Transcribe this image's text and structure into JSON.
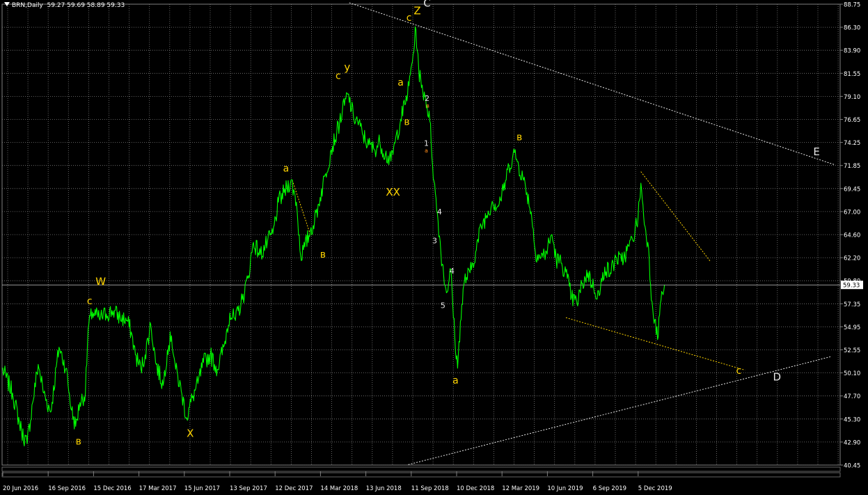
{
  "window": {
    "symbol_timeframe": "BRN,Daily",
    "ohlc": "59.27 59.69 58.89 59.33"
  },
  "colors": {
    "background": "#000000",
    "grid": "#7f7f7f",
    "price_line": "#00ff00",
    "wave_label_yellow": "#ffd400",
    "wave_label_white": "#e6e6e6",
    "trendline_white": "#e8e8e8",
    "trendline_yellow": "#ffd400",
    "axis_text": "#ffffff"
  },
  "chart_data": {
    "type": "line",
    "title": "",
    "xlabel": "",
    "ylabel": "",
    "ylim": [
      40.45,
      88.75
    ],
    "grid": true,
    "current_price": 59.33,
    "y_ticks": [
      "88.75",
      "86.30",
      "83.90",
      "81.55",
      "79.10",
      "76.65",
      "74.25",
      "71.85",
      "69.45",
      "67.00",
      "64.60",
      "62.20",
      "59.80",
      "57.35",
      "54.95",
      "52.55",
      "50.10",
      "47.70",
      "45.30",
      "42.90",
      "40.45"
    ],
    "x_ticks": [
      "20 Jun 2016",
      "16 Sep 2016",
      "15 Dec 2016",
      "17 Mar 2017",
      "15 Jun 2017",
      "13 Sep 2017",
      "12 Dec 2017",
      "14 Mar 2018",
      "13 Jun 2018",
      "11 Sep 2018",
      "10 Dec 2018",
      "12 Mar 2019",
      "10 Jun 2019",
      "6 Sep 2019",
      "5 Dec 2019"
    ],
    "x_range": [
      0,
      1207
    ],
    "series": [
      {
        "points": [
          [
            0,
            50.6
          ],
          [
            15,
            48
          ],
          [
            28,
            44
          ],
          [
            36,
            42.7
          ],
          [
            44,
            47
          ],
          [
            52,
            51
          ],
          [
            60,
            48
          ],
          [
            70,
            46
          ],
          [
            82,
            52.8
          ],
          [
            92,
            50.6
          ],
          [
            100,
            46.2
          ],
          [
            106,
            44.5
          ],
          [
            112,
            47
          ],
          [
            120,
            48
          ],
          [
            124,
            54.8
          ],
          [
            130,
            56.5
          ],
          [
            140,
            55.8
          ],
          [
            150,
            56.3
          ],
          [
            160,
            56.6
          ],
          [
            170,
            55.9
          ],
          [
            180,
            55.6
          ],
          [
            186,
            54.4
          ],
          [
            192,
            52
          ],
          [
            200,
            50.5
          ],
          [
            206,
            52
          ],
          [
            214,
            55.2
          ],
          [
            222,
            51
          ],
          [
            232,
            48.8
          ],
          [
            238,
            52.5
          ],
          [
            244,
            54
          ],
          [
            250,
            50.5
          ],
          [
            258,
            48.2
          ],
          [
            266,
            45.4
          ],
          [
            274,
            47.5
          ],
          [
            282,
            49
          ],
          [
            290,
            51.2
          ],
          [
            300,
            52
          ],
          [
            310,
            50.5
          ],
          [
            320,
            53
          ],
          [
            328,
            56.4
          ],
          [
            336,
            55.6
          ],
          [
            346,
            57.8
          ],
          [
            354,
            60
          ],
          [
            362,
            63.8
          ],
          [
            372,
            62.5
          ],
          [
            382,
            63.8
          ],
          [
            390,
            64.7
          ],
          [
            398,
            68
          ],
          [
            406,
            69
          ],
          [
            416,
            70.3
          ],
          [
            424,
            68
          ],
          [
            430,
            62.4
          ],
          [
            436,
            63.3
          ],
          [
            444,
            65
          ],
          [
            450,
            66
          ],
          [
            458,
            68.5
          ],
          [
            466,
            71
          ],
          [
            474,
            73.5
          ],
          [
            482,
            75.3
          ],
          [
            490,
            77.5
          ],
          [
            498,
            79.3
          ],
          [
            506,
            77
          ],
          [
            512,
            76.5
          ],
          [
            520,
            75
          ],
          [
            528,
            74
          ],
          [
            536,
            73.5
          ],
          [
            544,
            74.3
          ],
          [
            552,
            73
          ],
          [
            560,
            72.3
          ],
          [
            566,
            74.2
          ],
          [
            574,
            76.7
          ],
          [
            580,
            78.2
          ],
          [
            586,
            80.2
          ],
          [
            592,
            83.5
          ],
          [
            596,
            86.1
          ],
          [
            600,
            82
          ],
          [
            604,
            80
          ],
          [
            610,
            79
          ],
          [
            616,
            76.5
          ],
          [
            622,
            70.2
          ],
          [
            628,
            66
          ],
          [
            634,
            61.5
          ],
          [
            640,
            58.5
          ],
          [
            646,
            61
          ],
          [
            652,
            53.8
          ],
          [
            656,
            50.6
          ],
          [
            660,
            55.5
          ],
          [
            666,
            59.8
          ],
          [
            674,
            60.6
          ],
          [
            682,
            62.8
          ],
          [
            690,
            65.5
          ],
          [
            698,
            66.6
          ],
          [
            706,
            68.1
          ],
          [
            714,
            67.6
          ],
          [
            722,
            69.2
          ],
          [
            730,
            71.8
          ],
          [
            738,
            73.2
          ],
          [
            744,
            71.8
          ],
          [
            750,
            70.6
          ],
          [
            756,
            69
          ],
          [
            762,
            67
          ],
          [
            768,
            62.8
          ],
          [
            776,
            62.2
          ],
          [
            784,
            62.8
          ],
          [
            792,
            64.6
          ],
          [
            798,
            62
          ],
          [
            806,
            61.6
          ],
          [
            814,
            60
          ],
          [
            820,
            58
          ],
          [
            828,
            57.4
          ],
          [
            836,
            59.5
          ],
          [
            844,
            60.6
          ],
          [
            852,
            59
          ],
          [
            860,
            58.2
          ],
          [
            868,
            61.2
          ],
          [
            876,
            60.6
          ],
          [
            884,
            62.2
          ],
          [
            892,
            61.8
          ],
          [
            900,
            62.9
          ],
          [
            908,
            64.1
          ],
          [
            916,
            66.4
          ],
          [
            920,
            70
          ],
          [
            924,
            66.5
          ],
          [
            930,
            63.8
          ],
          [
            936,
            57.6
          ],
          [
            940,
            55.7
          ],
          [
            944,
            53.6
          ],
          [
            948,
            57.4
          ],
          [
            954,
            59.3
          ]
        ]
      }
    ],
    "trendlines": [
      {
        "style": "white-dotted",
        "points": [
          [
            500,
            88.9
          ],
          [
            1200,
            71.9
          ]
        ]
      },
      {
        "style": "white-dotted",
        "points": [
          [
            585,
            40.5
          ],
          [
            1193,
            51.8
          ]
        ]
      },
      {
        "style": "yellow-dotted",
        "points": [
          [
            920,
            71.2
          ],
          [
            1020,
            61.8
          ]
        ]
      },
      {
        "style": "yellow-dotted",
        "points": [
          [
            812,
            55.9
          ],
          [
            1070,
            50.4
          ]
        ]
      },
      {
        "style": "yellow-dotted",
        "points": [
          [
            418,
            70.3
          ],
          [
            444,
            64.6
          ]
        ]
      }
    ],
    "annotations": [
      {
        "text": "C",
        "x": 612,
        "y": 88.5,
        "color": "white",
        "size": 15
      },
      {
        "text": "Z",
        "x": 598,
        "y": 87.7,
        "color": "yellow",
        "size": 15
      },
      {
        "text": "c",
        "x": 586,
        "y": 87.0,
        "color": "yellow",
        "size": 14
      },
      {
        "text": "E",
        "x": 1173,
        "y": 72.9,
        "color": "white",
        "size": 15
      },
      {
        "text": "D",
        "x": 1116,
        "y": 49.3,
        "color": "white",
        "size": 15
      },
      {
        "text": "c",
        "x": 1061,
        "y": 50.0,
        "color": "yellow",
        "size": 14
      },
      {
        "text": "y",
        "x": 497,
        "y": 81.8,
        "color": "yellow",
        "size": 15
      },
      {
        "text": "c",
        "x": 484,
        "y": 80.9,
        "color": "yellow",
        "size": 14
      },
      {
        "text": "a",
        "x": 574,
        "y": 80.2,
        "color": "yellow",
        "size": 14
      },
      {
        "text": "в",
        "x": 583,
        "y": 76.1,
        "color": "yellow",
        "size": 14
      },
      {
        "text": "XX",
        "x": 563,
        "y": 68.7,
        "color": "yellow",
        "size": 15
      },
      {
        "text": "2",
        "x": 612,
        "y": 78.6,
        "color": "white",
        "size": 11
      },
      {
        "text": "в",
        "x": 613,
        "y": 77.9,
        "color": "orange",
        "size": 8
      },
      {
        "text": "1",
        "x": 611,
        "y": 73.9,
        "color": "white",
        "size": 11
      },
      {
        "text": "a",
        "x": 611,
        "y": 73.2,
        "color": "orange",
        "size": 8
      },
      {
        "text": "4",
        "x": 630,
        "y": 66.7,
        "color": "white",
        "size": 11
      },
      {
        "text": "3",
        "x": 623,
        "y": 63.7,
        "color": "white",
        "size": 11
      },
      {
        "text": "4",
        "x": 648,
        "y": 60.5,
        "color": "white",
        "size": 11
      },
      {
        "text": "5",
        "x": 635,
        "y": 56.9,
        "color": "white",
        "size": 11
      },
      {
        "text": "a",
        "x": 653,
        "y": 49.0,
        "color": "yellow",
        "size": 14
      },
      {
        "text": "в",
        "x": 745,
        "y": 74.5,
        "color": "yellow",
        "size": 14
      },
      {
        "text": "a",
        "x": 409,
        "y": 71.2,
        "color": "yellow",
        "size": 14
      },
      {
        "text": "в",
        "x": 462,
        "y": 62.2,
        "color": "yellow",
        "size": 14
      },
      {
        "text": "W",
        "x": 142,
        "y": 59.3,
        "color": "yellow",
        "size": 15
      },
      {
        "text": "c",
        "x": 126,
        "y": 57.3,
        "color": "yellow",
        "size": 14
      },
      {
        "text": "X",
        "x": 271,
        "y": 43.4,
        "color": "yellow",
        "size": 15
      },
      {
        "text": "в",
        "x": 110,
        "y": 42.6,
        "color": "yellow",
        "size": 14
      }
    ]
  }
}
